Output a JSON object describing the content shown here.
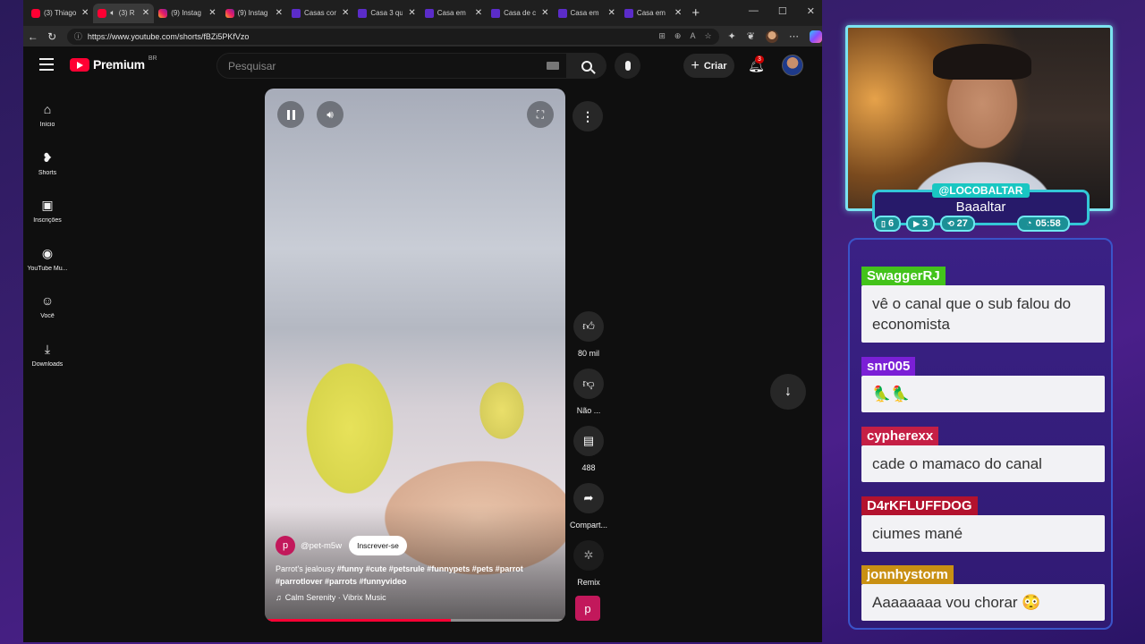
{
  "browser": {
    "tabs": [
      {
        "title": "(3) Thiago",
        "icon": "youtube",
        "active": false,
        "audio": false
      },
      {
        "title": "(3) R",
        "icon": "youtube",
        "active": true,
        "audio": true
      },
      {
        "title": "(9) Instag",
        "icon": "instagram",
        "active": false,
        "audio": false
      },
      {
        "title": "(9) Instag",
        "icon": "instagram",
        "active": false,
        "audio": false
      },
      {
        "title": "Casas cor",
        "icon": "site",
        "active": false,
        "audio": false
      },
      {
        "title": "Casa 3 qu",
        "icon": "site",
        "active": false,
        "audio": false
      },
      {
        "title": "Casa em",
        "icon": "site",
        "active": false,
        "audio": false
      },
      {
        "title": "Casa de c",
        "icon": "site",
        "active": false,
        "audio": false
      },
      {
        "title": "Casa em",
        "icon": "site",
        "active": false,
        "audio": false
      },
      {
        "title": "Casa em",
        "icon": "site",
        "active": false,
        "audio": false
      }
    ],
    "url": "https://www.youtube.com/shorts/fBZi5PKfVzo"
  },
  "youtube": {
    "logo_text": "Premium",
    "region": "BR",
    "search_placeholder": "Pesquisar",
    "create_label": "Criar",
    "notifications": "3",
    "sidebar": [
      {
        "label": "Início",
        "icon": "home-icon"
      },
      {
        "label": "Shorts",
        "icon": "shorts-icon"
      },
      {
        "label": "Inscrições",
        "icon": "subscriptions-icon"
      },
      {
        "label": "YouTube Mu...",
        "icon": "youtube-music-icon"
      },
      {
        "label": "Você",
        "icon": "user-icon"
      },
      {
        "label": "Downloads",
        "icon": "download-icon"
      }
    ],
    "short": {
      "channel": "@pet-m5w",
      "channel_initial": "p",
      "subscribe_label": "Inscrever-se",
      "caption_plain": "Parrot's jealousy ",
      "caption_tags": "#funny #cute #petsrule #funnypets #pets #parrot #parrotlover #parrots #funnyvideo",
      "music": "Calm Serenity · Vibrix Music",
      "progress": 0.62
    },
    "actions": {
      "likes": "80 mil",
      "dislike": "Não ...",
      "comments": "488",
      "share": "Compart...",
      "remix": "Remix"
    }
  },
  "stream": {
    "handle": "@LOCOBALTAR",
    "display_name": "Baaaltar",
    "stats": [
      {
        "icon": "twitch-icon",
        "value": "6"
      },
      {
        "icon": "youtube-icon",
        "value": "3"
      },
      {
        "icon": "kick-icon",
        "value": "27"
      }
    ],
    "timer": "05:58"
  },
  "chat": [
    {
      "user": "SwaggerRJ",
      "color": "#43c31b",
      "text": "vê o canal que o sub falou do economista"
    },
    {
      "user": "snr005",
      "color": "#7b1fd6",
      "text": "🦜🦜"
    },
    {
      "user": "cypherexx",
      "color": "#c51f45",
      "text": "cade o mamaco do canal"
    },
    {
      "user": "D4rKFLUFFDOG",
      "color": "#b3122e",
      "text": "ciumes mané"
    },
    {
      "user": "jonnhystorm",
      "color": "#c99013",
      "text": "Aaaaaaaa vou chorar 😳"
    }
  ]
}
